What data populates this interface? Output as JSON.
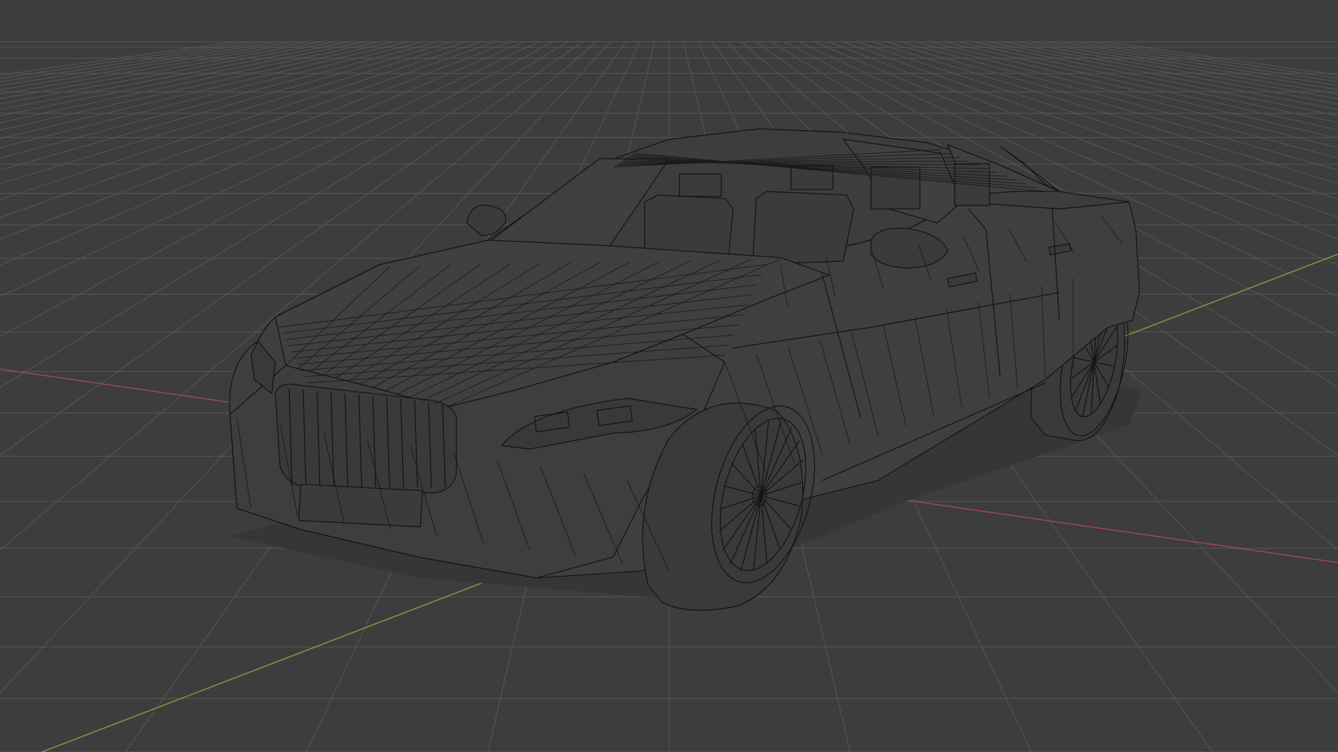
{
  "viewport": {
    "mode": "3d-viewport-wireframe",
    "background_color": "#3d3d3d",
    "grid_color": "#545454",
    "x_axis_color": "#9a4a4e",
    "y_axis_color": "#7a9a3e",
    "wire_color": "#141414",
    "body_fill_color": "#3f3f3f",
    "shadow_fill_color": "#363636"
  },
  "scene": {
    "object": "car-mesh",
    "display": "wireframe",
    "grid": true,
    "axes_visible": [
      "x",
      "y"
    ]
  }
}
